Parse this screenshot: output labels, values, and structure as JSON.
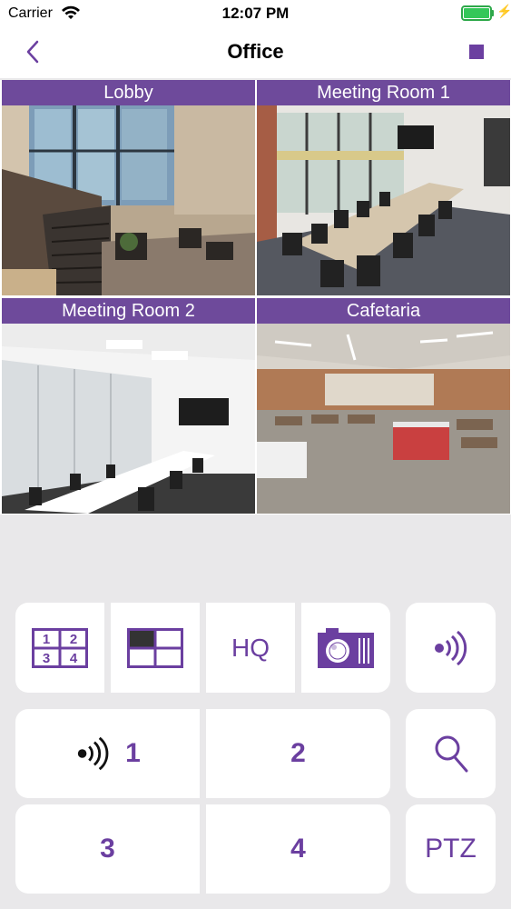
{
  "status_bar": {
    "carrier": "Carrier",
    "time": "12:07 PM",
    "battery_level": 1.0
  },
  "nav": {
    "title": "Office",
    "back_icon": "chevron-left-icon",
    "stop_icon": "stop-icon"
  },
  "cameras": [
    {
      "label": "Lobby"
    },
    {
      "label": "Meeting Room 1"
    },
    {
      "label": "Meeting Room 2"
    },
    {
      "label": "Cafetaria"
    }
  ],
  "toolbar": {
    "layout_quad": {
      "icon": "quad-layout-icon",
      "digits": [
        "1",
        "2",
        "3",
        "4"
      ]
    },
    "layout_split_icon": "split-layout-icon",
    "hq_label": "HQ",
    "snapshot_icon": "camera-icon",
    "audio_icon": "audio-wave-icon"
  },
  "channels": [
    {
      "label": "1",
      "icon": "audio-wave-icon"
    },
    {
      "label": "2"
    },
    {
      "label": "3"
    },
    {
      "label": "4"
    }
  ],
  "zoom_icon": "magnifier-icon",
  "ptz_label": "PTZ",
  "colors": {
    "accent": "#6b3fa0",
    "tile_label_bg": "#6e4a9b",
    "background": "#e9e8ea"
  }
}
